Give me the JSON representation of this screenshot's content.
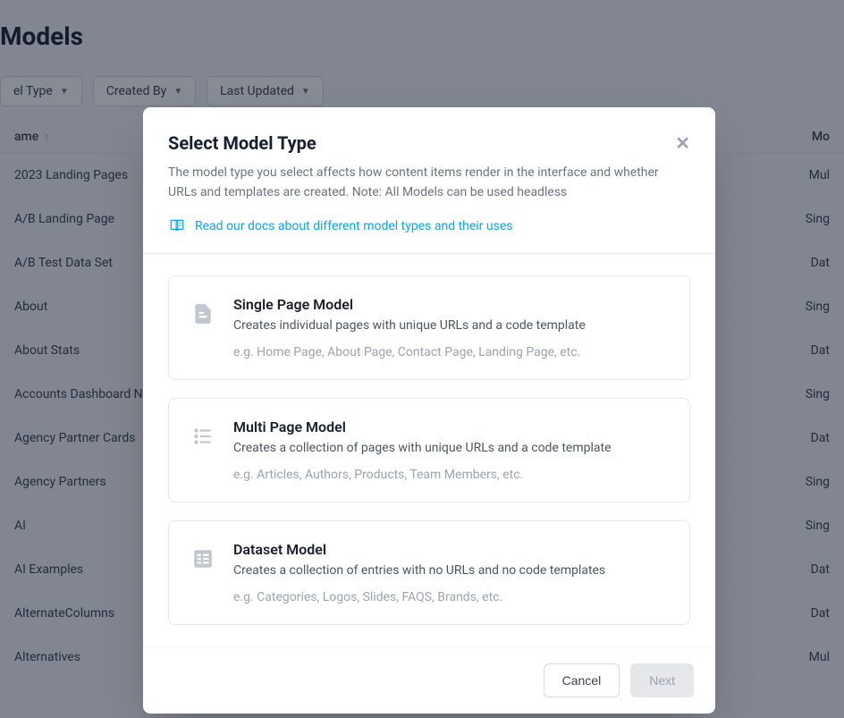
{
  "page": {
    "title": "Models"
  },
  "filters": {
    "model_type": "el Type",
    "created_by": "Created By",
    "last_updated": "Last Updated"
  },
  "table": {
    "header_name": "ame",
    "header_type": "Mo",
    "rows": [
      {
        "name": "2023 Landing Pages",
        "type": "Mul"
      },
      {
        "name": "A/B Landing Page",
        "type": "Sing"
      },
      {
        "name": "A/B Test Data Set",
        "type": "Dat"
      },
      {
        "name": "About",
        "type": "Sing"
      },
      {
        "name": "About Stats",
        "type": "Dat"
      },
      {
        "name": "Accounts Dashboard N",
        "type": "Sing"
      },
      {
        "name": "Agency Partner Cards",
        "type": "Dat"
      },
      {
        "name": "Agency Partners",
        "type": "Sing"
      },
      {
        "name": "AI",
        "type": "Sing"
      },
      {
        "name": "AI Examples",
        "type": "Dat"
      },
      {
        "name": "AlternateColumns",
        "type": "Dat"
      },
      {
        "name": "Alternatives",
        "type": "Mul"
      }
    ]
  },
  "modal": {
    "title": "Select Model Type",
    "description": "The model type you select affects how content items render in the interface and whether URLs and templates are created. Note: All Models can be used headless",
    "docs_link": "Read our docs about different model types and their uses",
    "options": [
      {
        "title": "Single Page Model",
        "subtitle": "Creates individual pages with unique URLs and a code template",
        "hint": "e.g. Home Page, About Page, Contact Page, Landing Page, etc."
      },
      {
        "title": "Multi Page Model",
        "subtitle": "Creates a collection of pages with unique URLs and a code template",
        "hint": "e.g. Articles, Authors, Products, Team Members, etc."
      },
      {
        "title": "Dataset Model",
        "subtitle": "Creates a collection of entries with no URLs and no code templates",
        "hint": "e.g. Categories, Logos, Slides, FAQS, Brands, etc."
      }
    ],
    "cancel": "Cancel",
    "next": "Next"
  }
}
